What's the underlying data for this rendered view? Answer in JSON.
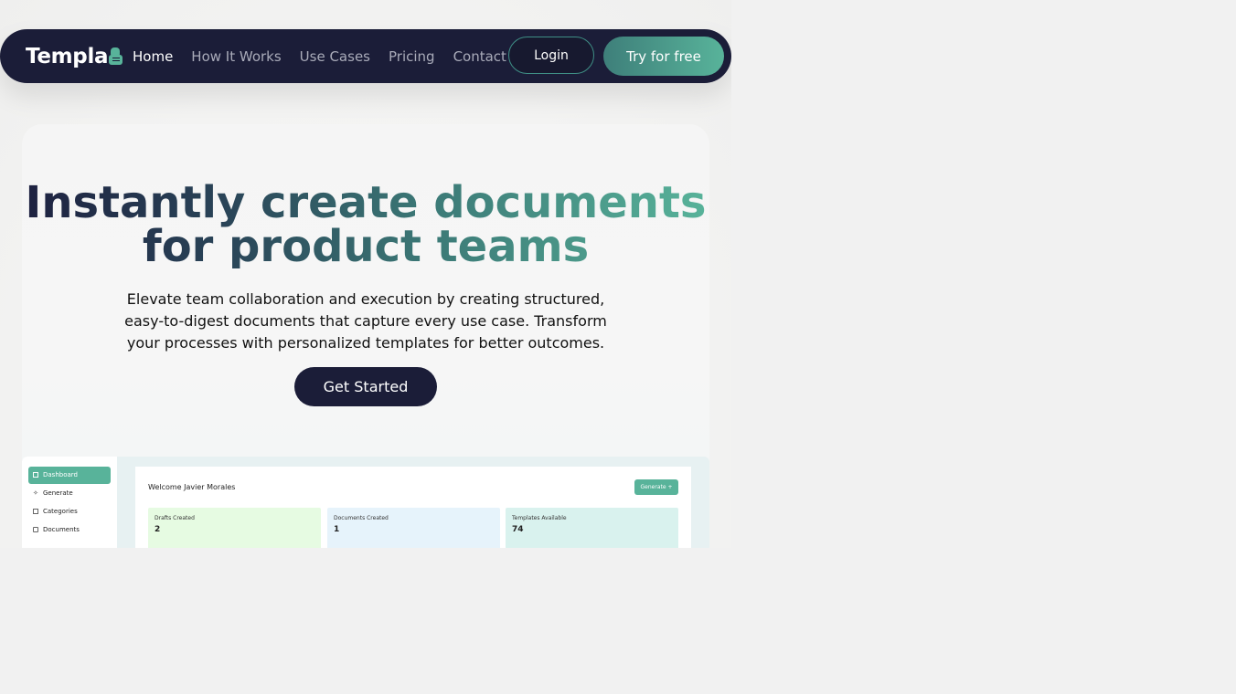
{
  "nav": {
    "logo": "Templa",
    "links": [
      "Home",
      "How It Works",
      "Use Cases",
      "Pricing",
      "Contact"
    ],
    "login": "Login",
    "try": "Try for free"
  },
  "hero": {
    "headline_line1": "Instantly create documents",
    "headline_line2": "for product teams",
    "subtitle": "Elevate team collaboration and execution by creating structured, easy-to-digest documents that capture every use case. Transform your processes with personalized templates for better outcomes.",
    "cta": "Get Started"
  },
  "preview": {
    "sidebar": [
      "Dashboard",
      "Generate",
      "Categories",
      "Documents"
    ],
    "welcome": "Welcome Javier Morales",
    "generate": "Generate +",
    "stats": [
      {
        "label": "Drafts Created",
        "value": "2",
        "color": "#e6fbe2"
      },
      {
        "label": "Documents Created",
        "value": "1",
        "color": "#e6f3fb"
      },
      {
        "label": "Templates Available",
        "value": "74",
        "color": "#d9f2ee"
      }
    ]
  },
  "colors": {
    "navy": "#1b1d38",
    "accent": "#58b39a"
  }
}
